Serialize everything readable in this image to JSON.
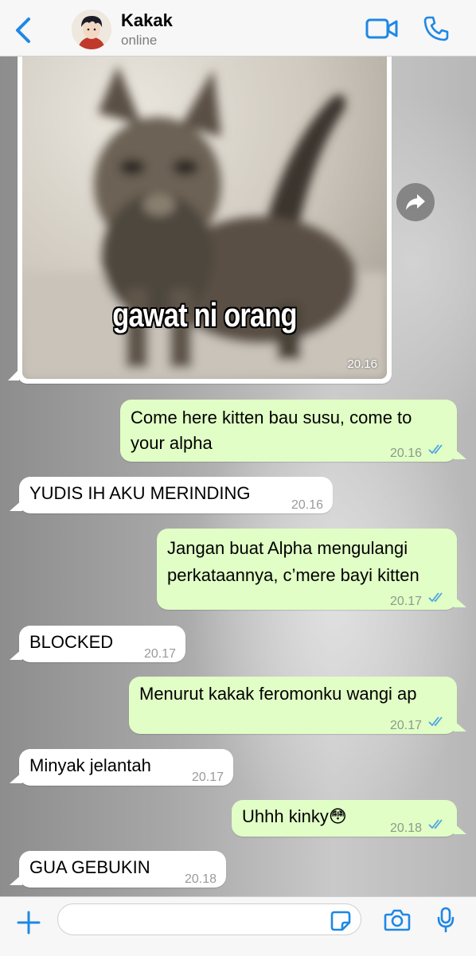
{
  "header": {
    "back_icon": "chevron-left-icon",
    "contact_name": "Kakak",
    "status": "online",
    "video_icon": "video-camera-icon",
    "call_icon": "phone-icon",
    "accent_color": "#1e88e5"
  },
  "image_message": {
    "caption": "gawat ni orang",
    "time": "20.16",
    "forward_icon": "forward-arrow-icon"
  },
  "messages": [
    {
      "direction": "out",
      "lines": [
        "Come here kitten bau susu, come to",
        "your alpha"
      ],
      "time": "20.16",
      "status": "read"
    },
    {
      "direction": "in",
      "lines": [
        "YUDIS IH AKU MERINDING"
      ],
      "time": "20.16"
    },
    {
      "direction": "out",
      "lines": [
        "Jangan buat Alpha mengulangi",
        "perkataannya, c’mere bayi kitten"
      ],
      "time": "20.17",
      "status": "read"
    },
    {
      "direction": "in",
      "lines": [
        "BLOCKED"
      ],
      "time": "20.17"
    },
    {
      "direction": "out",
      "lines": [
        "Menurut kakak feromonku wangi ap"
      ],
      "time": "20.17",
      "status": "read"
    },
    {
      "direction": "in",
      "lines": [
        "Minyak jelantah"
      ],
      "time": "20.17"
    },
    {
      "direction": "out",
      "lines": [
        "Uhhh kinky😳"
      ],
      "time": "20.18",
      "status": "read"
    },
    {
      "direction": "in",
      "lines": [
        "GUA GEBUKIN"
      ],
      "time": "20.18"
    }
  ],
  "input_bar": {
    "placeholder": "",
    "value": "",
    "plus_icon": "plus-icon",
    "sticker_icon": "sticker-icon",
    "camera_icon": "camera-icon",
    "mic_icon": "microphone-icon"
  },
  "colors": {
    "outgoing_bubble": "#e1fec6",
    "incoming_bubble": "#ffffff",
    "read_tick": "#4fa3e0"
  }
}
